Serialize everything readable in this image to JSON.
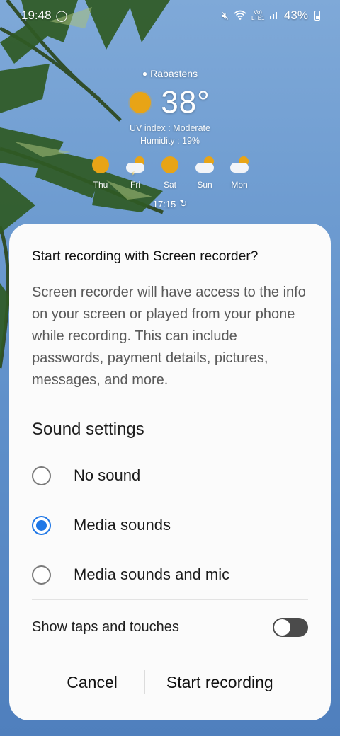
{
  "status_bar": {
    "time": "19:48",
    "left_icons": [
      "whatsapp-icon"
    ],
    "right_icons": [
      "mute-icon",
      "wifi-icon",
      "volte-lte-icon",
      "signal-icon"
    ],
    "network_label": "Vo) LTE1",
    "battery": "43%"
  },
  "weather": {
    "location": "Rabastens",
    "temperature": "38°",
    "uv_index": "UV index : Moderate",
    "humidity": "Humidity : 19%",
    "forecast": [
      {
        "day": "Thu",
        "icon": "sunny"
      },
      {
        "day": "Fri",
        "icon": "thunderstorm"
      },
      {
        "day": "Sat",
        "icon": "sunny"
      },
      {
        "day": "Sun",
        "icon": "partly-cloudy"
      },
      {
        "day": "Mon",
        "icon": "partly-cloudy"
      }
    ],
    "updated_time": "17:15"
  },
  "dialog": {
    "title": "Start recording with Screen recorder?",
    "description": "Screen recorder will have access to the info on your screen or played from your phone while recording. This can include passwords, payment details, pictures, messages, and more.",
    "sound_settings_title": "Sound settings",
    "sound_options": [
      {
        "label": "No sound",
        "selected": false
      },
      {
        "label": "Media sounds",
        "selected": true
      },
      {
        "label": "Media sounds and mic",
        "selected": false
      }
    ],
    "show_taps_label": "Show taps and touches",
    "show_taps_enabled": false,
    "cancel_label": "Cancel",
    "start_label": "Start recording"
  },
  "colors": {
    "accent": "#1f77e6",
    "sun": "#e8a416",
    "dialog_bg": "#fbfbfb"
  }
}
